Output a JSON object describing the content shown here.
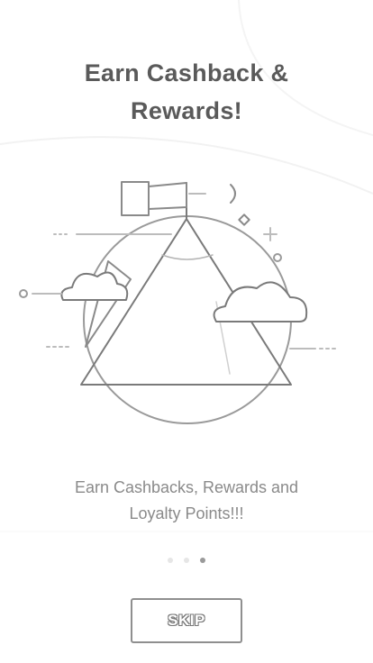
{
  "onboarding": {
    "title_lines": [
      "Earn Cashback &",
      "Rewards!"
    ],
    "subtitle_lines": [
      "Earn Cashbacks, Rewards and",
      "Loyalty Points!!!"
    ],
    "page_count": 3,
    "current_page": 3,
    "skip_label": "SKIP"
  },
  "colors": {
    "title": "#5a5a5a",
    "subtitle": "#8a8a8a",
    "line_art": "#7a7a7a",
    "dot_inactive": "#e6e6e6",
    "dot_active": "#9a9a9a"
  }
}
